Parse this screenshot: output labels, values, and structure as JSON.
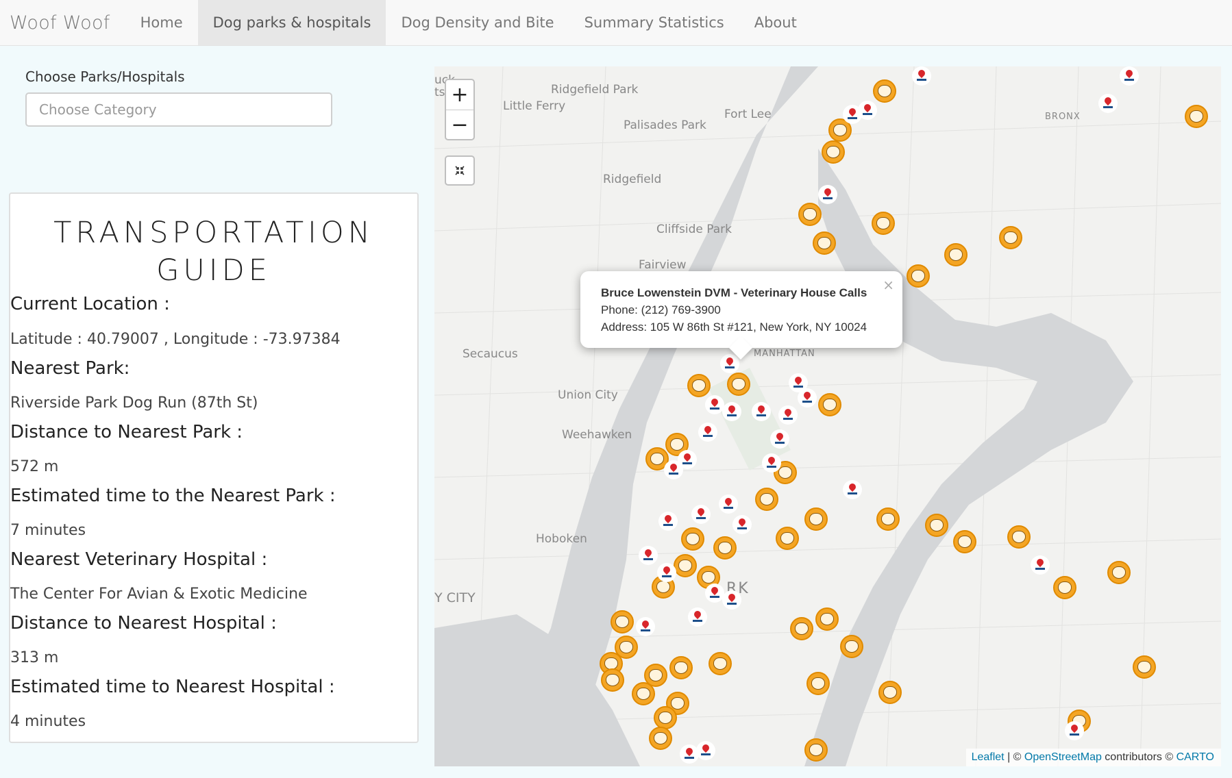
{
  "navbar": {
    "brand": "Woof Woof",
    "items": [
      {
        "label": "Home",
        "active": false
      },
      {
        "label": "Dog parks & hospitals",
        "active": true
      },
      {
        "label": "Dog Density and Bite",
        "active": false
      },
      {
        "label": "Summary Statistics",
        "active": false
      },
      {
        "label": "About",
        "active": false
      }
    ]
  },
  "filter": {
    "label": "Choose Parks/Hospitals",
    "placeholder": "Choose Category"
  },
  "guide": {
    "title": "TRANSPORTATION GUIDE",
    "current_location_label": "Current Location :",
    "current_location_value": "Latitude : 40.79007 , Longitude : -73.97384",
    "nearest_park_label": "Nearest Park:",
    "nearest_park_value": "Riverside Park Dog Run (87th St)",
    "dist_park_label": "Distance to Nearest Park :",
    "dist_park_value": "572 m",
    "time_park_label": "Estimated time to the Nearest Park :",
    "time_park_value": "7 minutes",
    "nearest_hosp_label": "Nearest Veterinary Hospital :",
    "nearest_hosp_value": "The Center For Avian & Exotic Medicine",
    "dist_hosp_label": "Distance to Nearest Hospital :",
    "dist_hosp_value": "313 m",
    "time_hosp_label": "Estimated time to Nearest Hospital :",
    "time_hosp_value": "4 minutes"
  },
  "map": {
    "zoom_in": "+",
    "zoom_out": "−",
    "fullscreen_icon": "collapse-arrows-icon",
    "places": [
      "Ridgefield Park",
      "Little Ferry",
      "Palisades Park",
      "Fort Lee",
      "Ridgefield",
      "Cliffside Park",
      "Fairview",
      "Secaucus",
      "Union City",
      "Weehawken",
      "Hoboken",
      "BRONX",
      "MANHATTAN",
      "RK",
      "Y CITY",
      "uck",
      "ts"
    ],
    "popup": {
      "name": "Bruce Lowenstein DVM - Veterinary House Calls",
      "phone": "Phone: (212) 769-3900",
      "address": "Address: 105 W 86th St #121, New York, NY 10024",
      "close": "×"
    },
    "attribution": {
      "leaflet": "Leaflet",
      "sep": " | © ",
      "osm": "OpenStreetMap",
      "contrib": " contributors © ",
      "carto": "CARTO"
    },
    "colors": {
      "water": "#d4d6d8",
      "land": "#f2f2f0",
      "park_marker": "#f4a524",
      "hospital_red": "#d8262b"
    }
  }
}
